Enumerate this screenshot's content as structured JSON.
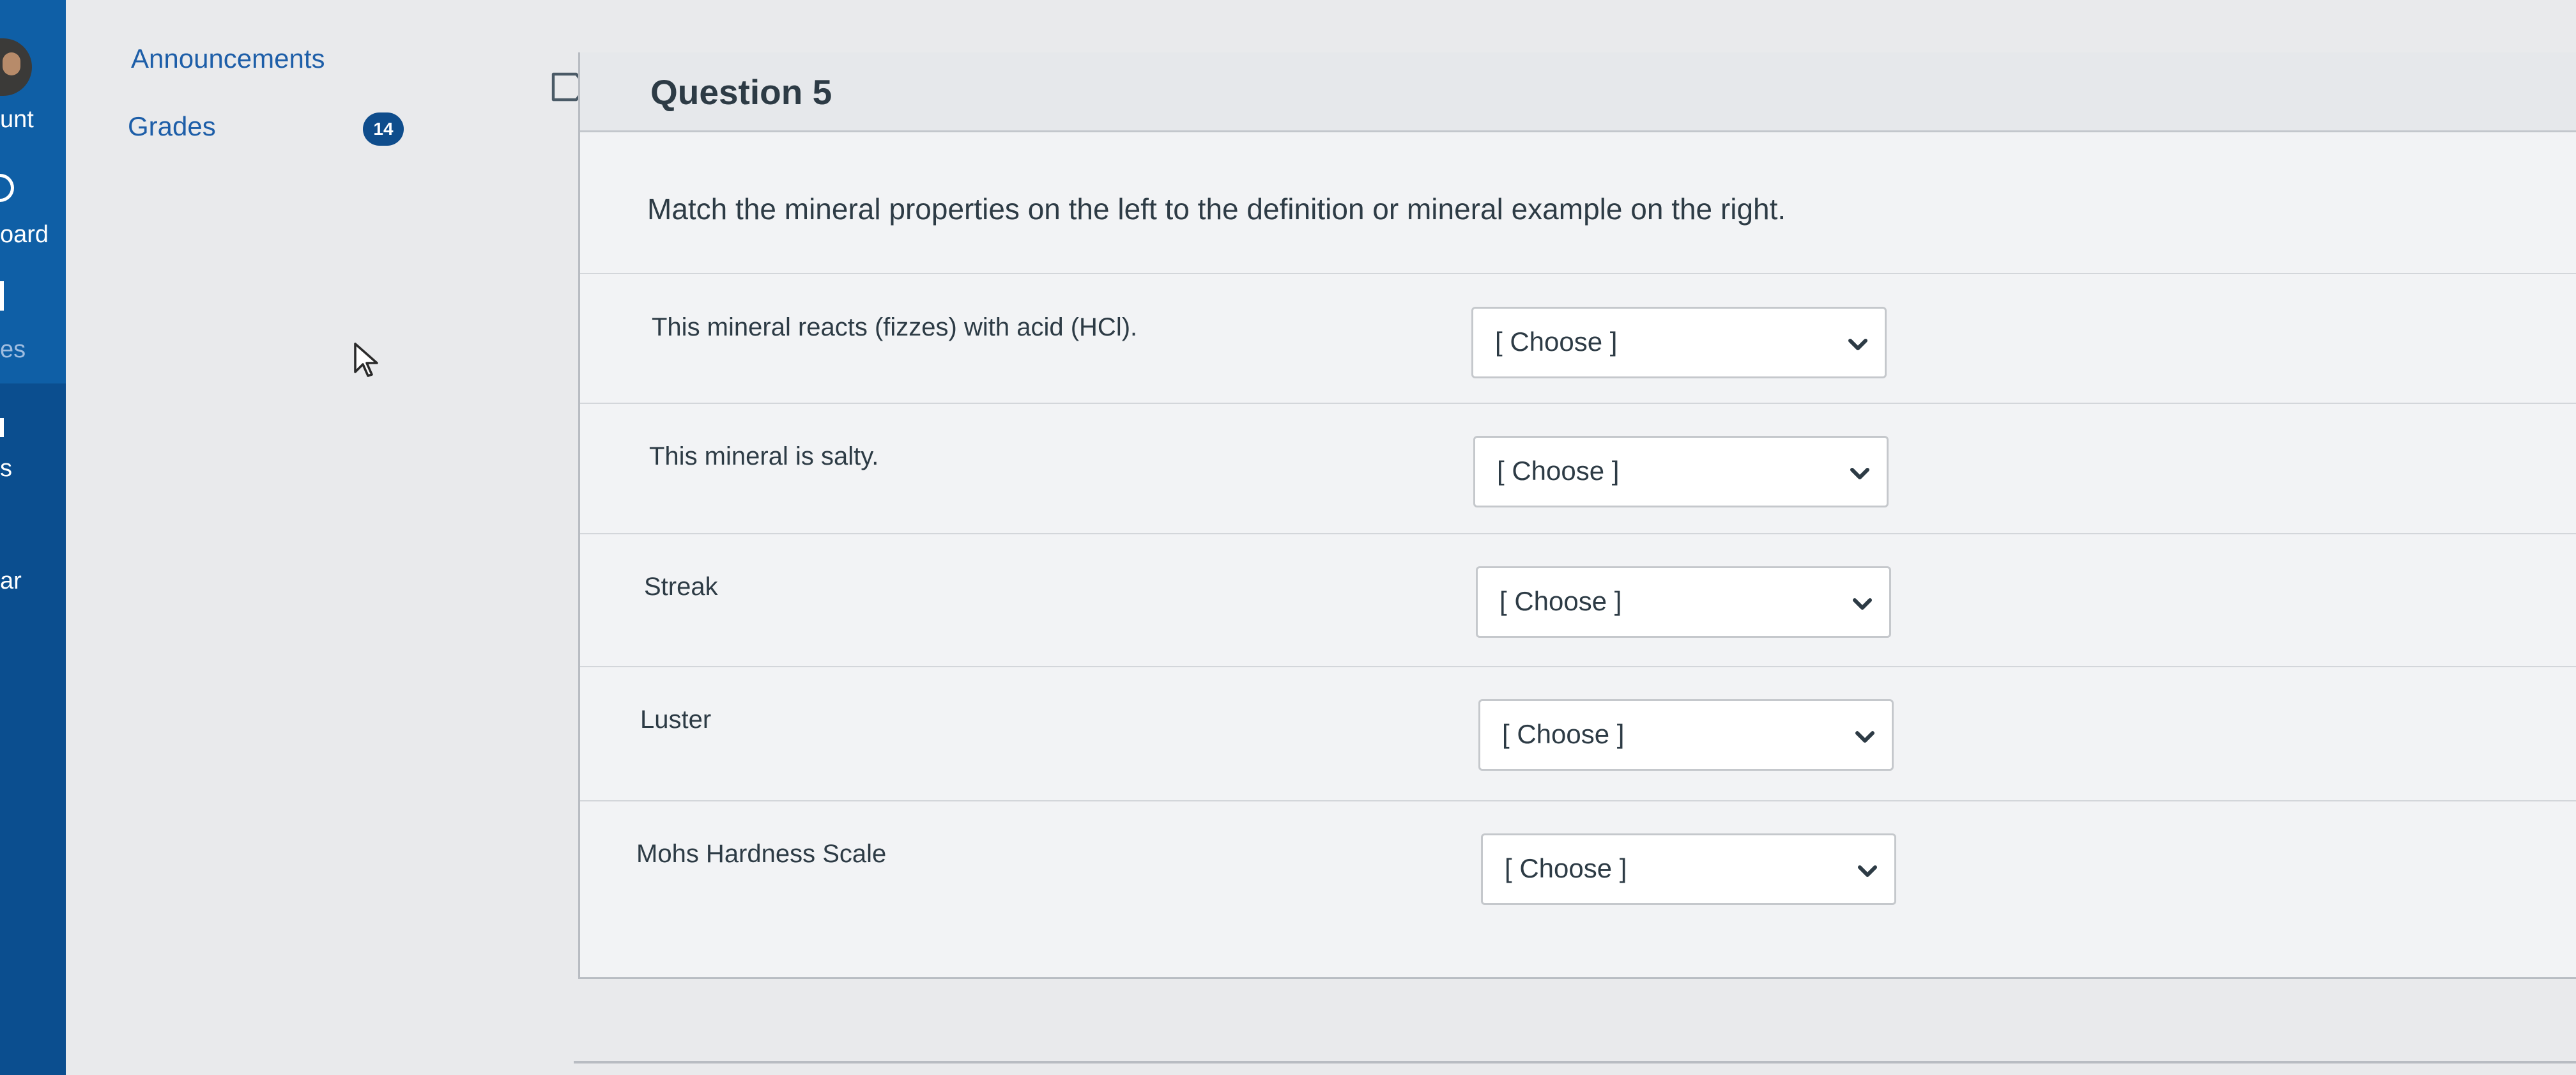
{
  "global_nav": {
    "items": [
      {
        "label": "unt"
      },
      {
        "label": "oard"
      },
      {
        "label": "es"
      },
      {
        "label": "s"
      },
      {
        "label": "ar"
      }
    ]
  },
  "course_nav": {
    "announcements": "Announcements",
    "grades": "Grades",
    "grades_badge": "14"
  },
  "question": {
    "title": "Question 5",
    "prompt": "Match the mineral properties on the left to the deﬁnition or mineral example on the right.",
    "rows": [
      {
        "label": "This mineral reacts (ﬁzzes) with acid (HCl).",
        "selected": "[ Choose ]"
      },
      {
        "label": "This mineral is salty.",
        "selected": "[ Choose ]"
      },
      {
        "label": "Streak",
        "selected": "[ Choose ]"
      },
      {
        "label": "Luster",
        "selected": "[ Choose ]"
      },
      {
        "label": "Mohs Hardness Scale",
        "selected": "[ Choose ]"
      }
    ]
  },
  "colors": {
    "nav_blue": "#0b4e8f",
    "link_blue": "#1d5ea8",
    "text_dark": "#2d3b45"
  }
}
